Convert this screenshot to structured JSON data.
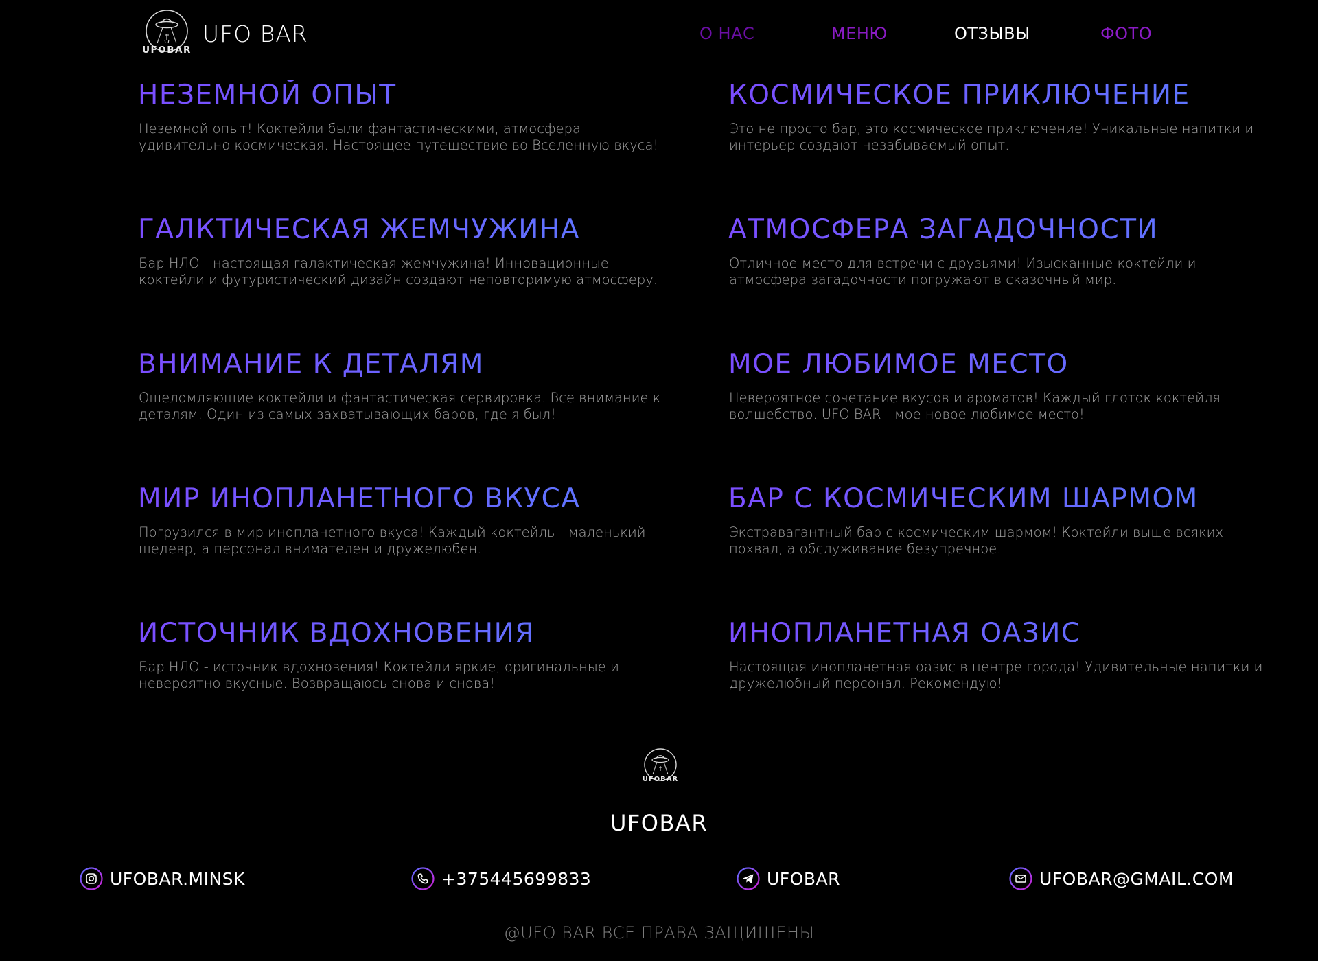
{
  "header": {
    "logo_text": "UFOBAR",
    "brand": "UFO BAR",
    "nav": [
      {
        "label": "О НАС",
        "color": "#6b0fa5"
      },
      {
        "label": "МЕНЮ",
        "color": "#8a1bc4"
      },
      {
        "label": "ОТЗЫВЫ",
        "color": "#ffffff"
      },
      {
        "label": "ФОТО",
        "color": "#8a1bc4"
      }
    ]
  },
  "reviews": [
    {
      "title": "НЕЗЕМНОЙ ОПЫТ",
      "text": "Неземной опыт! Коктейли были фантастическими, атмосфера удивительно космическая. Настоящее путешествие во Вселенную вкуса!"
    },
    {
      "title": "КОСМИЧЕСКОЕ ПРИКЛЮЧЕНИЕ",
      "text": "Это не просто бар, это космическое приключение! Уникальные напитки и интерьер создают незабываемый опыт."
    },
    {
      "title": "ГАЛКТИЧЕСКАЯ ЖЕМЧУЖИНА",
      "text": "Бар НЛО - настоящая галактическая жемчужина! Инновационные коктейли и футуристический дизайн создают неповторимую атмосферу."
    },
    {
      "title": "АТМОСФЕРА ЗАГАДОЧНОСТИ",
      "text": "Отличное место для встречи с друзьями! Изысканные коктейли и атмосфера загадочности погружают в сказочный мир."
    },
    {
      "title": "ВНИМАНИЕ К ДЕТАЛЯМ",
      "text": "Ошеломляющие коктейли и фантастическая сервировка. Все внимание к деталям. Один из самых захватывающих баров, где я был!"
    },
    {
      "title": "МОЕ ЛЮБИМОЕ МЕСТО",
      "text": "Невероятное сочетание вкусов и ароматов! Каждый глоток коктейля волшебство. UFO BAR - мое новое любимое место!"
    },
    {
      "title": "МИР ИНОПЛАНЕТНОГО ВКУСА",
      "text": "Погрузился в мир инопланетного вкуса! Каждый коктейль - маленький шедевр, а персонал внимателен и дружелюбен."
    },
    {
      "title": "БАР С КОСМИЧЕСКИМ ШАРМОМ",
      "text": "Экстравагантный бар с космическим шармом! Коктейли выше всяких похвал, а обслуживание безупречное."
    },
    {
      "title": "ИСТОЧНИК ВДОХНОВЕНИЯ",
      "text": "Бар НЛО - источник вдохновения! Коктейли яркие, оригинальные и невероятно вкусные. Возвращаюсь снова и снова!"
    },
    {
      "title": "ИНОПЛАНЕТНАЯ ОАЗИС",
      "text": "Настоящая инопланетная оазис в центре города! Удивительные напитки и дружелюбный персонал. Рекомендую!"
    }
  ],
  "footer": {
    "logo_text": "UFOBAR",
    "brand": "UFOBAR",
    "contacts": [
      {
        "icon": "instagram-icon",
        "label": "UFOBAR.MINSK"
      },
      {
        "icon": "phone-icon",
        "label": "+375445699833"
      },
      {
        "icon": "telegram-icon",
        "label": "UFOBAR"
      },
      {
        "icon": "mail-icon",
        "label": "UFOBAR@GMAIL.COM"
      }
    ],
    "copyright": "@UFO BAR ВСЕ ПРАВА ЗАЩИЩЕНЫ"
  },
  "theme": {
    "background": "#000000",
    "title_gradient_start": "#7b4dff",
    "title_gradient_end": "#5a7bff",
    "body_text": "#a0a0a0",
    "icon_gradient_start": "#5b6cff",
    "icon_gradient_end": "#d21fd8"
  }
}
